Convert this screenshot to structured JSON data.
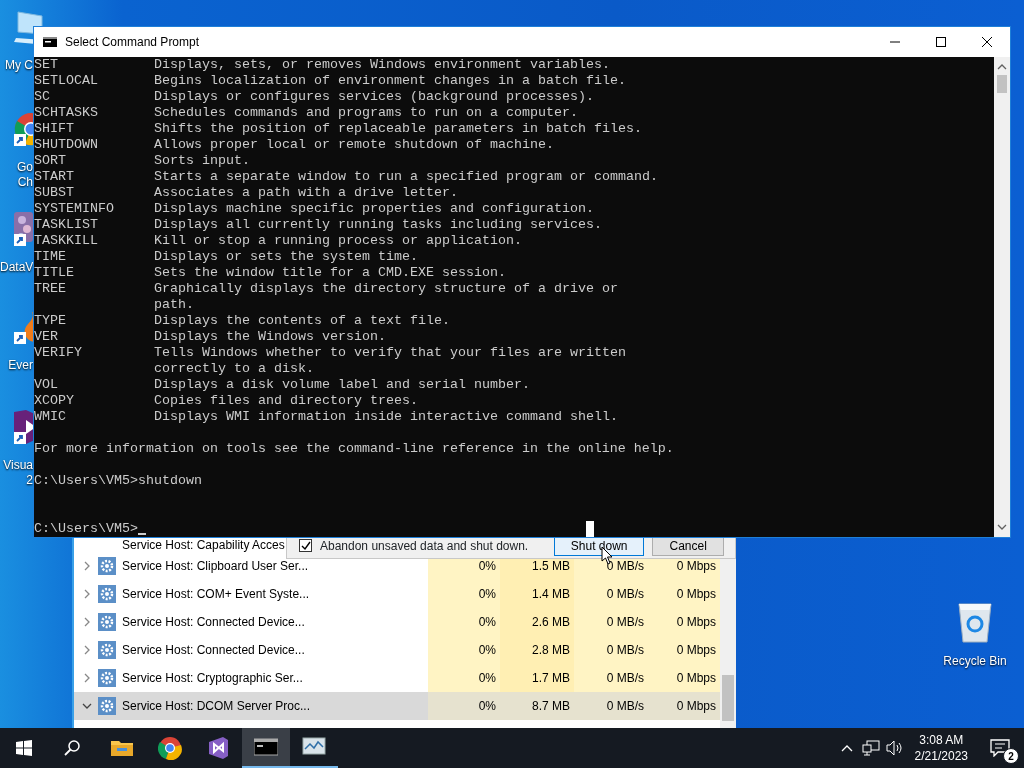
{
  "desktop_icons": [
    {
      "kind": "computer",
      "lines": [
        "My C"
      ]
    },
    {
      "kind": "chrome",
      "lines": [
        "Go",
        "Ch"
      ]
    },
    {
      "kind": "dataviz",
      "lines": [
        "DataV"
      ]
    },
    {
      "kind": "everything",
      "lines": [
        "Ever"
      ]
    },
    {
      "kind": "studio",
      "lines": [
        "Visua",
        "2"
      ]
    }
  ],
  "recycle_bin": {
    "label": "Recycle Bin"
  },
  "task_manager": {
    "rows": [
      {
        "name": "Service Host: Capability Acces",
        "selected": false
      },
      {
        "name": "Service Host: Clipboard User Ser...",
        "cpu": "0%",
        "memory": "1.5 MB",
        "disk": "0 MB/s",
        "network": "0 Mbps",
        "expanded": false,
        "selected": false
      },
      {
        "name": "Service Host: COM+ Event Syste...",
        "cpu": "0%",
        "memory": "1.4 MB",
        "disk": "0 MB/s",
        "network": "0 Mbps",
        "expanded": false,
        "selected": false
      },
      {
        "name": "Service Host: Connected Device...",
        "cpu": "0%",
        "memory": "2.6 MB",
        "disk": "0 MB/s",
        "network": "0 Mbps",
        "expanded": false,
        "selected": false
      },
      {
        "name": "Service Host: Connected Device...",
        "cpu": "0%",
        "memory": "2.8 MB",
        "disk": "0 MB/s",
        "network": "0 Mbps",
        "expanded": false,
        "selected": false
      },
      {
        "name": "Service Host: Cryptographic Ser...",
        "cpu": "0%",
        "memory": "1.7 MB",
        "disk": "0 MB/s",
        "network": "0 Mbps",
        "expanded": false,
        "selected": false
      },
      {
        "name": "Service Host: DCOM Server Proc...",
        "cpu": "0%",
        "memory": "8.7 MB",
        "disk": "0 MB/s",
        "network": "0 Mbps",
        "expanded": true,
        "selected": true
      }
    ]
  },
  "shutdown_dialog": {
    "checkbox": {
      "label": "Abandon unsaved data and shut down.",
      "checked": true
    },
    "buttons": [
      {
        "label": "Shut down",
        "focused": true
      },
      {
        "label": "Cancel",
        "focused": false
      }
    ]
  },
  "command_prompt": {
    "title": "Select Command Prompt",
    "lines": [
      {
        "command": "SET",
        "description": "Displays, sets, or removes Windows environment variables."
      },
      {
        "command": "SETLOCAL",
        "description": "Begins localization of environment changes in a batch file."
      },
      {
        "command": "SC",
        "description": "Displays or configures services (background processes)."
      },
      {
        "command": "SCHTASKS",
        "description": "Schedules commands and programs to run on a computer."
      },
      {
        "command": "SHIFT",
        "description": "Shifts the position of replaceable parameters in batch files."
      },
      {
        "command": "SHUTDOWN",
        "description": "Allows proper local or remote shutdown of machine."
      },
      {
        "command": "SORT",
        "description": "Sorts input."
      },
      {
        "command": "START",
        "description": "Starts a separate window to run a specified program or command."
      },
      {
        "command": "SUBST",
        "description": "Associates a path with a drive letter."
      },
      {
        "command": "SYSTEMINFO",
        "description": "Displays machine specific properties and configuration."
      },
      {
        "command": "TASKLIST",
        "description": "Displays all currently running tasks including services."
      },
      {
        "command": "TASKKILL",
        "description": "Kill or stop a running process or application."
      },
      {
        "command": "TIME",
        "description": "Displays or sets the system time."
      },
      {
        "command": "TITLE",
        "description": "Sets the window title for a CMD.EXE session."
      },
      {
        "command": "TREE",
        "description": "Graphically displays the directory structure of a drive or"
      },
      {
        "description": "path."
      },
      {
        "command": "TYPE",
        "description": "Displays the contents of a text file."
      },
      {
        "command": "VER",
        "description": "Displays the Windows version."
      },
      {
        "command": "VERIFY",
        "description": "Tells Windows whether to verify that your files are written"
      },
      {
        "description": "correctly to a disk."
      },
      {
        "command": "VOL",
        "description": "Displays a disk volume label and serial number."
      },
      {
        "command": "XCOPY",
        "description": "Copies files and directory trees."
      },
      {
        "command": "WMIC",
        "description": "Displays WMI information inside interactive command shell."
      }
    ],
    "help_footer": "For more information on tools see the command-line reference in the online help.",
    "prompts": [
      {
        "text": "C:\\Users\\VM5>shutdown",
        "cursor": false
      },
      {
        "text": "C:\\Users\\VM5>",
        "cursor": true
      }
    ]
  },
  "taskbar": {
    "apps": [
      {
        "kind": "explorer",
        "running": false,
        "selected": false
      },
      {
        "kind": "chrome",
        "running": false,
        "selected": false
      },
      {
        "kind": "studio",
        "running": false,
        "selected": false
      },
      {
        "kind": "console",
        "running": true,
        "selected": true
      },
      {
        "kind": "monitor",
        "running": true,
        "selected": false
      }
    ],
    "time": "3:08 AM",
    "date": "2/21/2023",
    "notification_count": "2"
  }
}
